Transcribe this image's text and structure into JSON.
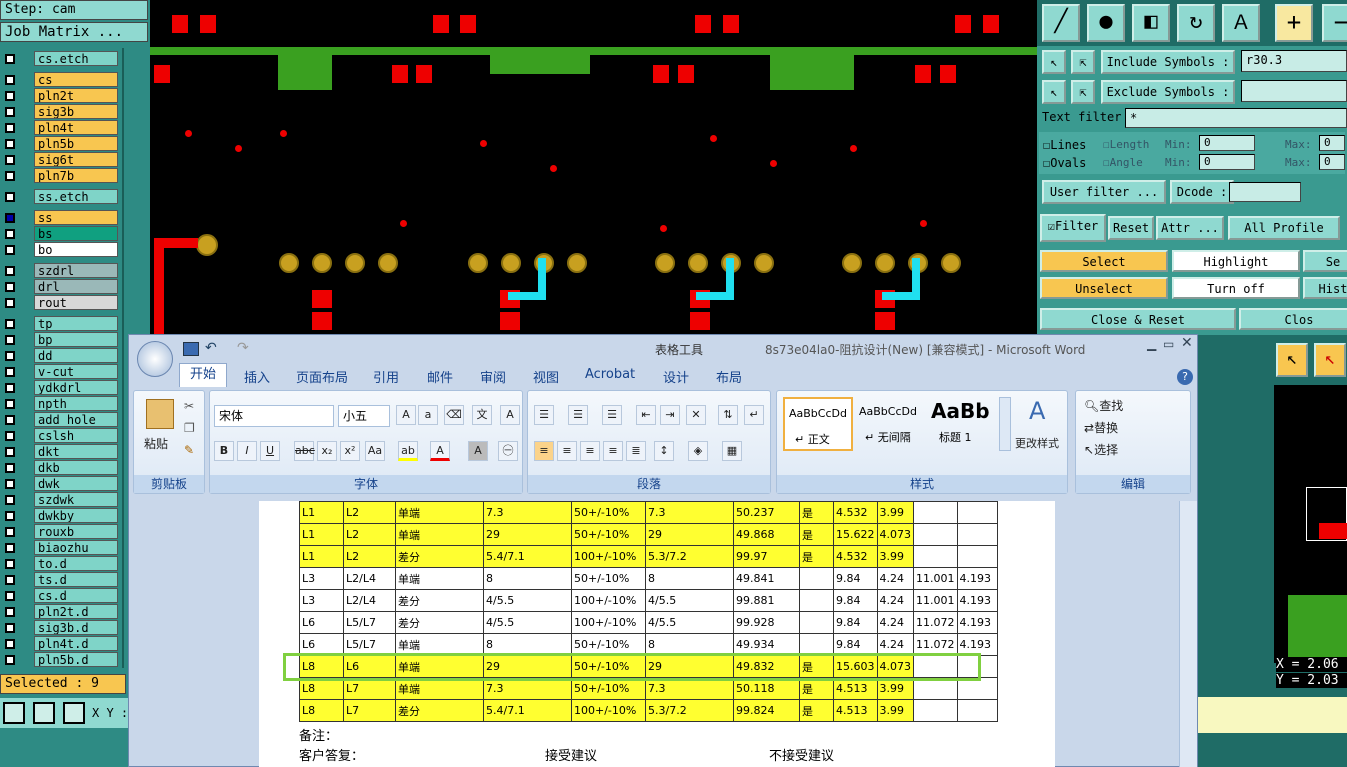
{
  "cam": {
    "step": "Step: cam",
    "job_matrix": "Job Matrix ...",
    "selected": "Selected : 9",
    "xy": "X Y :",
    "layers": [
      {
        "name": "cs.etch",
        "color": "teal",
        "sep": false
      },
      {
        "name": "cs",
        "color": "gold",
        "sep": true
      },
      {
        "name": "pln2t",
        "color": "gold"
      },
      {
        "name": "sig3b",
        "color": "gold"
      },
      {
        "name": "pln4t",
        "color": "gold"
      },
      {
        "name": "pln5b",
        "color": "gold"
      },
      {
        "name": "sig6t",
        "color": "gold"
      },
      {
        "name": "pln7b",
        "color": "gold"
      },
      {
        "name": "ss.etch",
        "color": "teal",
        "sep": true
      },
      {
        "name": "ss",
        "color": "gold",
        "sep": true
      },
      {
        "name": "bs",
        "color": "green"
      },
      {
        "name": "bo",
        "color": "white"
      },
      {
        "name": "szdrl",
        "color": "gray",
        "sep": true
      },
      {
        "name": "drl",
        "color": "gray"
      },
      {
        "name": "rout",
        "color": "lgray"
      },
      {
        "name": "tp",
        "color": "teal",
        "sep": true
      },
      {
        "name": "bp",
        "color": "teal"
      },
      {
        "name": "dd",
        "color": "teal"
      },
      {
        "name": "v-cut",
        "color": "teal"
      },
      {
        "name": "ydkdrl",
        "color": "teal"
      },
      {
        "name": "npth",
        "color": "teal"
      },
      {
        "name": "add_hole",
        "color": "teal"
      },
      {
        "name": "cslsh",
        "color": "teal"
      },
      {
        "name": "dkt",
        "color": "teal"
      },
      {
        "name": "dkb",
        "color": "teal"
      },
      {
        "name": "dwk",
        "color": "teal"
      },
      {
        "name": "szdwk",
        "color": "teal"
      },
      {
        "name": "dwkby",
        "color": "teal"
      },
      {
        "name": "rouxb",
        "color": "teal"
      },
      {
        "name": "biaozhu",
        "color": "teal"
      },
      {
        "name": "to.d",
        "color": "teal"
      },
      {
        "name": "ts.d",
        "color": "teal"
      },
      {
        "name": "cs.d",
        "color": "teal"
      },
      {
        "name": "pln2t.d",
        "color": "teal"
      },
      {
        "name": "sig3b.d",
        "color": "teal"
      },
      {
        "name": "pln4t.d",
        "color": "teal"
      },
      {
        "name": "pln5b.d",
        "color": "teal"
      }
    ],
    "filter": {
      "include_label": "Include Symbols :",
      "include_value": "r30.3",
      "exclude_label": "Exclude Symbols :",
      "exclude_value": "",
      "text_filter_label": "Text filter",
      "text_filter_value": "*",
      "lines": "Lines",
      "ovals": "Ovals",
      "length": "Length",
      "angle": "Angle",
      "min": "Min:",
      "max": "Max:",
      "min_val": "0",
      "max_val": "0",
      "user_filter": "User filter ...",
      "dcode": "Dcode :",
      "filter": "Filter",
      "reset": "Reset",
      "attr": "Attr ...",
      "all_profile": "All Profile",
      "select": "Select",
      "highlight": "Highlight",
      "sel_short": "Se",
      "unselect": "Unselect",
      "turn_off": "Turn off",
      "hist": "Hist",
      "close_reset": "Close & Reset",
      "close": "Clos"
    },
    "coords": {
      "x": "X = 2.06",
      "y": "Y = 2.03"
    }
  },
  "word": {
    "title": "8s73e04la0-阻抗设计(New) [兼容模式] - Microsoft Word",
    "context_tab": "表格工具",
    "tabs": [
      "开始",
      "插入",
      "页面布局",
      "引用",
      "邮件",
      "审阅",
      "视图",
      "Acrobat",
      "设计",
      "布局"
    ],
    "clipboard": {
      "paste": "粘贴",
      "label": "剪贴板"
    },
    "font": {
      "name": "宋体",
      "size": "小五",
      "label": "字体"
    },
    "paragraph": {
      "label": "段落"
    },
    "styles": {
      "label": "样式",
      "items": [
        {
          "preview": "AaBbCcDd",
          "name": "↵ 正文"
        },
        {
          "preview": "AaBbCcDd",
          "name": "↵ 无间隔"
        },
        {
          "preview": "AaBb",
          "name": "标题 1"
        }
      ],
      "change": "更改样式"
    },
    "editing": {
      "label": "编辑",
      "find": "查找",
      "replace": "替换",
      "select": "选择"
    },
    "rows": [
      [
        "L1",
        "L2",
        "单端",
        "7.3",
        "50+/-10%",
        "7.3",
        "50.237",
        "是",
        "4.532",
        "3.99",
        "",
        ""
      ],
      [
        "L1",
        "L2",
        "单端",
        "29",
        "50+/-10%",
        "29",
        "49.868",
        "是",
        "15.622",
        "4.073",
        "",
        ""
      ],
      [
        "L1",
        "L2",
        "差分",
        "5.4/7.1",
        "100+/-10%",
        "5.3/7.2",
        "99.97",
        "是",
        "4.532",
        "3.99",
        "",
        ""
      ],
      [
        "L3",
        "L2/L4",
        "单端",
        "8",
        "50+/-10%",
        "8",
        "49.841",
        "",
        "9.84",
        "4.24",
        "11.001",
        "4.193"
      ],
      [
        "L3",
        "L2/L4",
        "差分",
        "4/5.5",
        "100+/-10%",
        "4/5.5",
        "99.881",
        "",
        "9.84",
        "4.24",
        "11.001",
        "4.193"
      ],
      [
        "L6",
        "L5/L7",
        "差分",
        "4/5.5",
        "100+/-10%",
        "4/5.5",
        "99.928",
        "",
        "9.84",
        "4.24",
        "11.072",
        "4.193"
      ],
      [
        "L6",
        "L5/L7",
        "单端",
        "8",
        "50+/-10%",
        "8",
        "49.934",
        "",
        "9.84",
        "4.24",
        "11.072",
        "4.193"
      ],
      [
        "L8",
        "L6",
        "单端",
        "29",
        "50+/-10%",
        "29",
        "49.832",
        "是",
        "15.603",
        "4.073",
        "",
        ""
      ],
      [
        "L8",
        "L7",
        "单端",
        "7.3",
        "50+/-10%",
        "7.3",
        "50.118",
        "是",
        "4.513",
        "3.99",
        "",
        ""
      ],
      [
        "L8",
        "L7",
        "差分",
        "5.4/7.1",
        "100+/-10%",
        "5.3/7.2",
        "99.824",
        "是",
        "4.513",
        "3.99",
        "",
        ""
      ]
    ],
    "notes": {
      "remark": "备注：",
      "reply": "客户答复：",
      "accept": "接受建议",
      "reject": "不接受建议"
    }
  }
}
